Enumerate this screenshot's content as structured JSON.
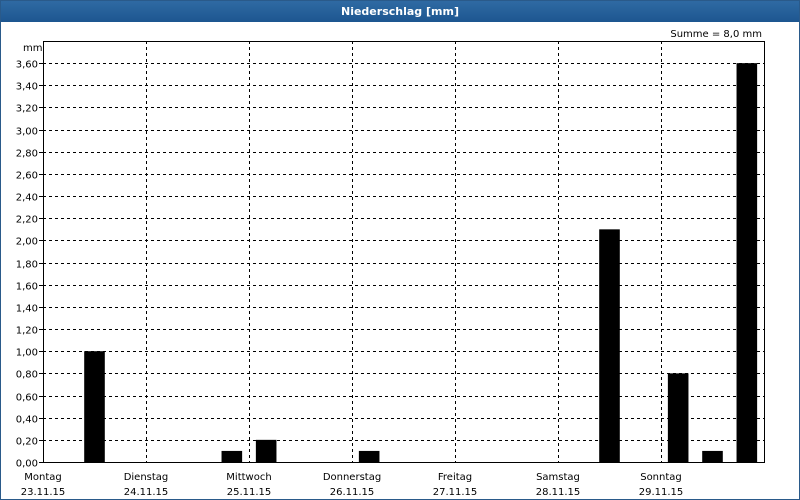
{
  "window": {
    "title": "Niederschlag [mm]"
  },
  "chart_data": {
    "type": "bar",
    "title": "Niederschlag [mm]",
    "ylabel": "mm",
    "sum_label": "Summe = 8,0 mm",
    "ylim": [
      0,
      3.8
    ],
    "y_ticks": [
      0,
      0.2,
      0.4,
      0.6,
      0.8,
      1.0,
      1.2,
      1.4,
      1.6,
      1.8,
      2.0,
      2.2,
      2.4,
      2.6,
      2.8,
      3.0,
      3.2,
      3.4,
      3.6
    ],
    "y_tick_labels": [
      "0,00",
      "0,20",
      "0,40",
      "0,60",
      "0,80",
      "1,00",
      "1,20",
      "1,40",
      "1,60",
      "1,80",
      "2,00",
      "2,20",
      "2,40",
      "2,60",
      "2,80",
      "3,00",
      "3,20",
      "3,40",
      "3,60"
    ],
    "x_range_days": [
      0,
      7
    ],
    "day_labels": [
      {
        "day": "Montag",
        "date": "23.11.15"
      },
      {
        "day": "Dienstag",
        "date": "24.11.15"
      },
      {
        "day": "Mittwoch",
        "date": "25.11.15"
      },
      {
        "day": "Donnerstag",
        "date": "26.11.15"
      },
      {
        "day": "Freitag",
        "date": "27.11.15"
      },
      {
        "day": "Samstag",
        "date": "28.11.15"
      },
      {
        "day": "Sonntag",
        "date": "29.11.15"
      }
    ],
    "bars": [
      {
        "period": 1,
        "value": 1.0
      },
      {
        "period": 5,
        "value": 0.1
      },
      {
        "period": 6,
        "value": 0.2
      },
      {
        "period": 9,
        "value": 0.1
      },
      {
        "period": 16,
        "value": 2.1
      },
      {
        "period": 18,
        "value": 0.8
      },
      {
        "period": 19,
        "value": 0.1
      },
      {
        "period": 20,
        "value": 3.6
      }
    ],
    "periods_total": 21,
    "grid": true,
    "bar_color": "#000000"
  }
}
